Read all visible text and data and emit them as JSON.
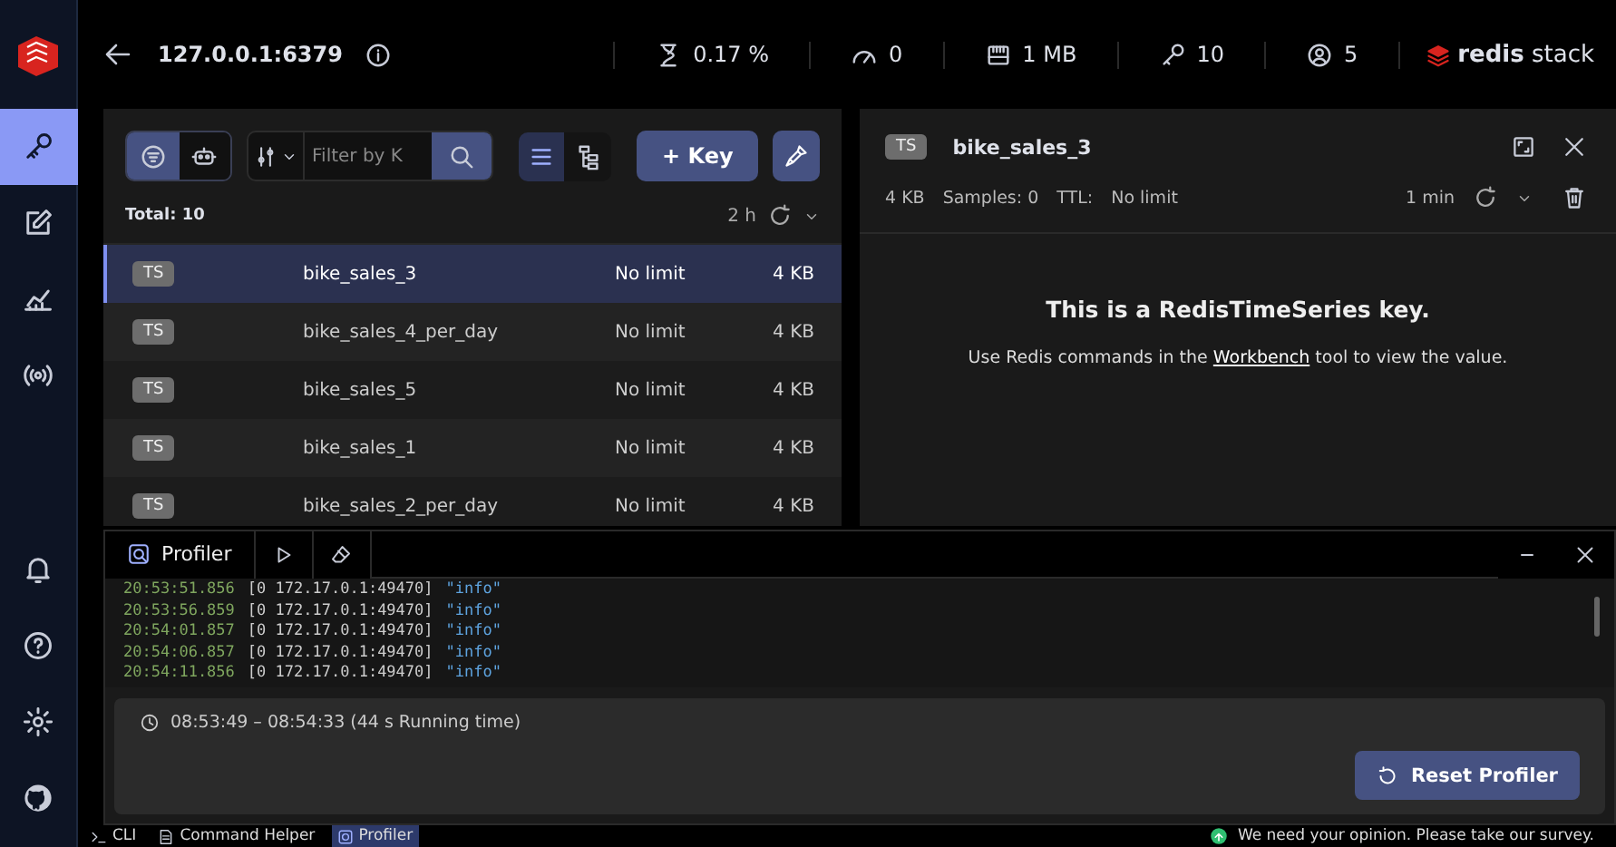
{
  "sidebar": {
    "items": [
      {
        "kind": "browser",
        "selected": true
      },
      {
        "kind": "workbench",
        "selected": false
      },
      {
        "kind": "analysis",
        "selected": false
      },
      {
        "kind": "pubsub",
        "selected": false
      }
    ],
    "bottom_items": [
      {
        "kind": "notifications"
      },
      {
        "kind": "help"
      },
      {
        "kind": "settings"
      },
      {
        "kind": "github"
      }
    ]
  },
  "header": {
    "host": "127.0.0.1:6379",
    "stats": [
      {
        "kind": "cpu",
        "value": "0.17 %"
      },
      {
        "kind": "ops",
        "value": "0"
      },
      {
        "kind": "memory",
        "value": "1 MB"
      },
      {
        "kind": "keys",
        "value": "10"
      },
      {
        "kind": "clients",
        "value": "5"
      }
    ],
    "brand": {
      "name": "redis",
      "suffix": "stack"
    }
  },
  "browser": {
    "filter_modes": [
      {
        "kind": "pattern",
        "selected": true
      },
      {
        "kind": "search",
        "selected": false
      }
    ],
    "search": {
      "placeholder": "Filter by K"
    },
    "views": [
      {
        "kind": "list",
        "selected": true
      },
      {
        "kind": "tree",
        "selected": false
      }
    ],
    "add_key": "+ Key",
    "total": "Total: 10",
    "refresh": "2 h",
    "rows": [
      {
        "type": "TS",
        "name": "bike_sales_3",
        "ttl": "No limit",
        "size": "4 KB",
        "selected": true
      },
      {
        "type": "TS",
        "name": "bike_sales_4_per_day",
        "ttl": "No limit",
        "size": "4 KB",
        "selected": false
      },
      {
        "type": "TS",
        "name": "bike_sales_5",
        "ttl": "No limit",
        "size": "4 KB",
        "selected": false
      },
      {
        "type": "TS",
        "name": "bike_sales_1",
        "ttl": "No limit",
        "size": "4 KB",
        "selected": false
      },
      {
        "type": "TS",
        "name": "bike_sales_2_per_day",
        "ttl": "No limit",
        "size": "4 KB",
        "selected": false
      }
    ]
  },
  "details": {
    "type": "TS",
    "name": "bike_sales_3",
    "size": "4 KB",
    "samples": "Samples: 0",
    "ttl_label": "TTL:",
    "ttl": "No limit",
    "refresh": "1 min",
    "heading": "This is a RedisTimeSeries key.",
    "message_before": "Use Redis commands in the",
    "link": "Workbench",
    "message_after": "tool to view the value."
  },
  "profiler": {
    "tab": "Profiler",
    "log": [
      {
        "time": "20:53:51.856",
        "client": "[0 172.17.0.1:49470]",
        "command": "\"info\""
      },
      {
        "time": "20:53:56.859",
        "client": "[0 172.17.0.1:49470]",
        "command": "\"info\""
      },
      {
        "time": "20:54:01.857",
        "client": "[0 172.17.0.1:49470]",
        "command": "\"info\""
      },
      {
        "time": "20:54:06.857",
        "client": "[0 172.17.0.1:49470]",
        "command": "\"info\""
      },
      {
        "time": "20:54:11.856",
        "client": "[0 172.17.0.1:49470]",
        "command": "\"info\""
      }
    ],
    "running_time": "08:53:49 – 08:54:33 (44 s Running time)",
    "reset": "Reset Profiler"
  },
  "status_bar": {
    "tabs": [
      {
        "kind": "cli",
        "label": "CLI",
        "selected": false
      },
      {
        "kind": "helper",
        "label": "Command Helper",
        "selected": false
      },
      {
        "kind": "profiler",
        "label": "Profiler",
        "selected": true
      }
    ],
    "survey": "We need your opinion. Please take our survey."
  }
}
